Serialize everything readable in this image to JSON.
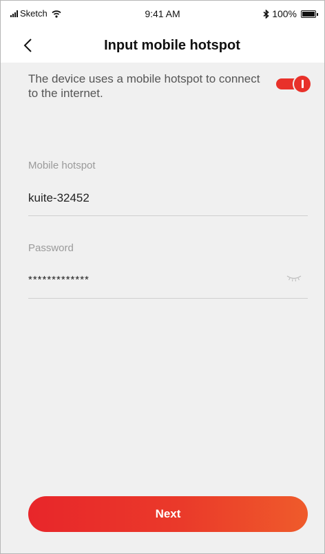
{
  "status_bar": {
    "carrier": "Sketch",
    "time": "9:41 AM",
    "battery": "100%",
    "icons": [
      "signal-icon",
      "wifi-icon",
      "bluetooth-icon",
      "battery-icon"
    ]
  },
  "nav": {
    "title": "Input mobile hotspot",
    "back_icon": "chevron-left-icon"
  },
  "hotspot_toggle": {
    "description": "The device uses a mobile hotspot to connect to the internet.",
    "enabled": true
  },
  "hotspot_field": {
    "label": "Mobile hotspot",
    "value": "kuite-32452"
  },
  "password_field": {
    "label": "Password",
    "value": "*************",
    "visibility_icon": "eye-closed-icon"
  },
  "next_button": {
    "label": "Next"
  },
  "colors": {
    "accent": "#e8312a",
    "accent_gradient_end": "#ef5b2b",
    "background": "#f0f0f0",
    "header_background": "#ffffff",
    "label_gray": "#9a9a9a",
    "divider": "#cfcfcf"
  }
}
